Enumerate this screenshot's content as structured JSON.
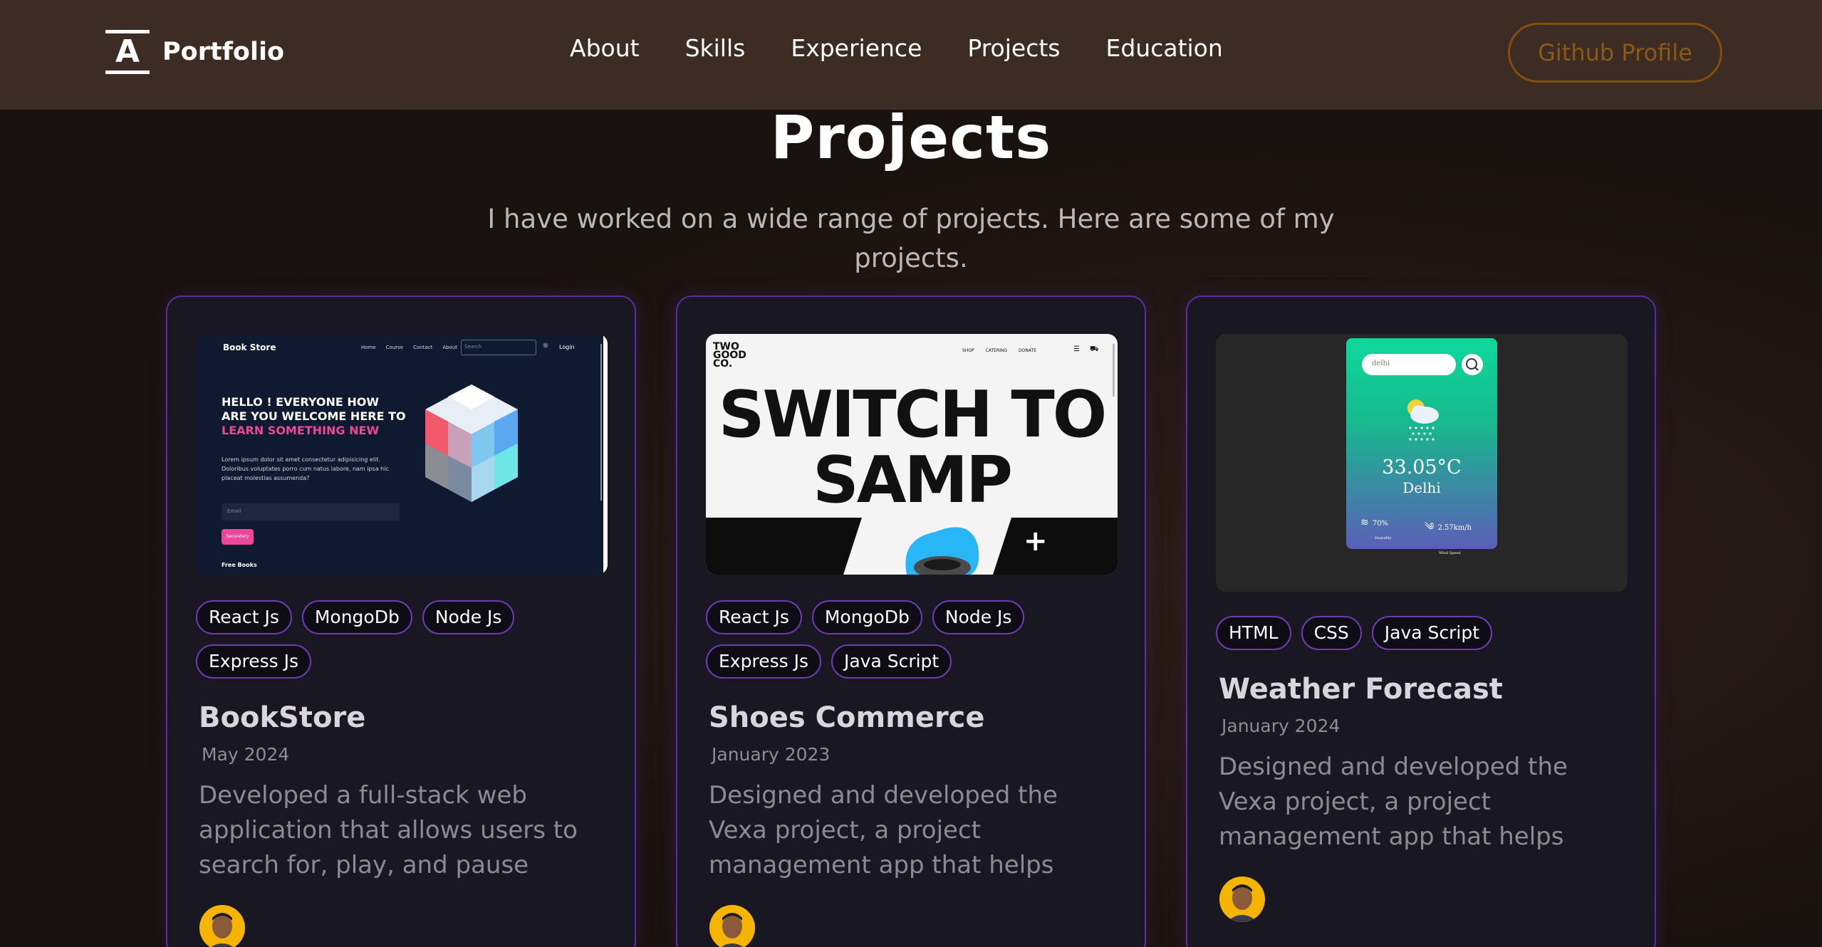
{
  "nav": {
    "brand_letter": "A",
    "brand_name": "Portfolio",
    "links": [
      "About",
      "Skills",
      "Experience",
      "Projects",
      "Education"
    ],
    "github_label": "Github Profile"
  },
  "section": {
    "title": "Projects",
    "description": "I have worked on a wide range of projects. Here are some of my projects."
  },
  "projects": [
    {
      "title": "BookStore",
      "date": "May 2024",
      "description": "Developed a full-stack web application that allows users to search for, play, and pause their...",
      "tags": [
        "React Js",
        "MongoDb",
        "Node Js",
        "Express Js"
      ],
      "thumb": {
        "brand": "Book Store",
        "nav": [
          "Home",
          "Course",
          "Contact",
          "About"
        ],
        "search_placeholder": "Search",
        "login": "Login",
        "heading_line": "HELLO ! EVERYONE HOW ARE YOU WELCOME HERE TO",
        "heading_accent": "LEARN SOMETHING NEW",
        "body": "Lorem ipsum dolor sit amet consectetur adipisicing elit. Doloribus voluptates porro cum natus labore, nam ipsa hic placeat molestias assumenda?",
        "email_placeholder": "Email",
        "button": "Secondary",
        "footer": "Free Books"
      }
    },
    {
      "title": "Shoes Commerce",
      "date": "January 2023",
      "description": "Designed and developed the Vexa project, a project management app that helps users and teams...",
      "tags": [
        "React Js",
        "MongoDb",
        "Node Js",
        "Express Js",
        "Java Script"
      ],
      "thumb": {
        "logo": "TWO GOOD CO.",
        "nav": [
          "SHOP",
          "CATERING",
          "DONATE"
        ],
        "headline": "SWITCH TO SAMP",
        "plus": "+"
      }
    },
    {
      "title": "Weather Forecast",
      "date": "January 2024",
      "description": "Designed and developed the Vexa project, a project management app that helps users and teams...",
      "tags": [
        "HTML",
        "CSS",
        "Java Script"
      ],
      "thumb": {
        "search_value": "delhi",
        "temperature": "33.05°C",
        "city": "Delhi",
        "humidity_value": "70%",
        "humidity_label": "Humidity",
        "wind_value": "2.57km/h",
        "wind_label": "Wind Speed"
      }
    }
  ],
  "colors": {
    "nav_bg": "#3c2c23",
    "page_bg": "#1a1210",
    "card_bg": "#191721",
    "card_border": "#5b2c9e",
    "accent_gold": "#854d0e",
    "pink": "#ec4899"
  }
}
